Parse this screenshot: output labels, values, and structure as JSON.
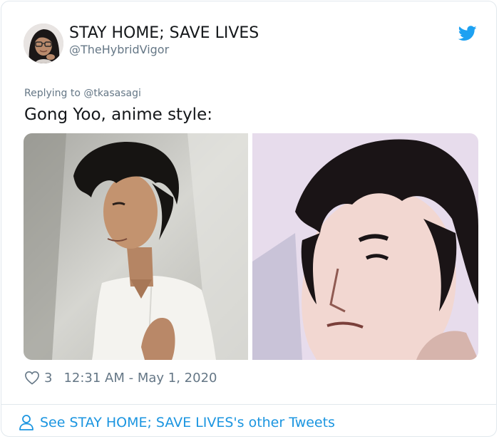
{
  "author": {
    "display_name": "STAY HOME; SAVE LIVES",
    "handle": "@TheHybridVigor"
  },
  "reply_context": {
    "prefix": "Replying to ",
    "mention": "@tkasasagi"
  },
  "tweet": {
    "text": "Gong Yoo, anime style:",
    "likes": "3",
    "timestamp": "12:31 AM - May 1, 2020"
  },
  "footer": {
    "other_tweets_link": "See STAY HOME; SAVE LIVES's other Tweets"
  },
  "icons": {
    "brand": "twitter-bird-icon",
    "like": "heart-outline-icon",
    "profile": "person-outline-icon"
  },
  "colors": {
    "twitter_blue": "#1da1f2",
    "link_blue": "#1b95e0",
    "secondary_text": "#657786",
    "primary_text": "#14171a",
    "border": "#e1e8ed"
  }
}
